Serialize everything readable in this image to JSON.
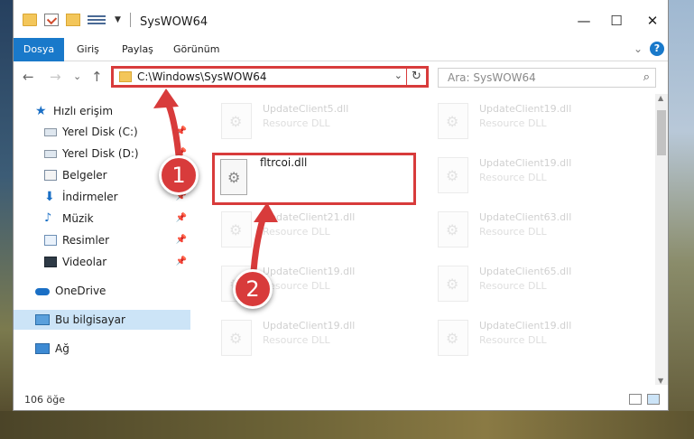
{
  "window": {
    "title": "SysWOW64",
    "minimize": "—",
    "maximize": "☐",
    "close": "✕"
  },
  "ribbon": {
    "tabs": [
      "Dosya",
      "Giriş",
      "Paylaş",
      "Görünüm"
    ],
    "collapse": "⌄",
    "help": "?"
  },
  "nav": {
    "back": "←",
    "forward": "→",
    "recent": "⌄",
    "up": "↑",
    "address": "C:\\Windows\\SysWOW64",
    "address_dropdown": "⌄",
    "refresh": "↻",
    "search_placeholder": "Ara: SysWOW64",
    "search_icon": "⌕"
  },
  "sidebar": {
    "items": [
      {
        "label": "Hızlı erişim",
        "icon": "star-icon",
        "pinned": false
      },
      {
        "label": "Yerel Disk (C:)",
        "icon": "drive-icon",
        "pinned": true
      },
      {
        "label": "Yerel Disk (D:)",
        "icon": "drive-icon",
        "pinned": true
      },
      {
        "label": "Belgeler",
        "icon": "documents-icon",
        "pinned": true
      },
      {
        "label": "İndirmeler",
        "icon": "download-icon",
        "pinned": true
      },
      {
        "label": "Müzik",
        "icon": "music-icon",
        "pinned": true
      },
      {
        "label": "Resimler",
        "icon": "pictures-icon",
        "pinned": true
      },
      {
        "label": "Videolar",
        "icon": "videos-icon",
        "pinned": true
      },
      {
        "label": "OneDrive",
        "icon": "cloud-icon",
        "pinned": false
      },
      {
        "label": "Bu bilgisayar",
        "icon": "computer-icon",
        "pinned": false,
        "selected": true
      },
      {
        "label": "Ağ",
        "icon": "network-icon",
        "pinned": false
      }
    ],
    "pin_glyph": "📌"
  },
  "files": {
    "highlighted": {
      "name": "fltrcoi.dll"
    },
    "left_column": [
      {
        "name": "UpdateClient5.dll",
        "type": "Resource DLL"
      },
      {
        "name": "UpdateClient21.dll",
        "type": "Resource DLL"
      },
      {
        "name": "UpdateClient19.dll",
        "type": "Resource DLL"
      },
      {
        "name": "UpdateClient19.dll",
        "type": "Resource DLL"
      }
    ],
    "right_column": [
      {
        "name": "UpdateClient19.dll",
        "type": "Resource DLL"
      },
      {
        "name": "UpdateClient19.dll",
        "type": "Resource DLL"
      },
      {
        "name": "UpdateClient63.dll",
        "type": "Resource DLL"
      },
      {
        "name": "UpdateClient65.dll",
        "type": "Resource DLL"
      },
      {
        "name": "UpdateClient19.dll",
        "type": "Resource DLL"
      }
    ]
  },
  "status": {
    "count": "106 öğe"
  },
  "annotations": {
    "badge1": "1",
    "badge2": "2",
    "color": "#d83b3b"
  }
}
